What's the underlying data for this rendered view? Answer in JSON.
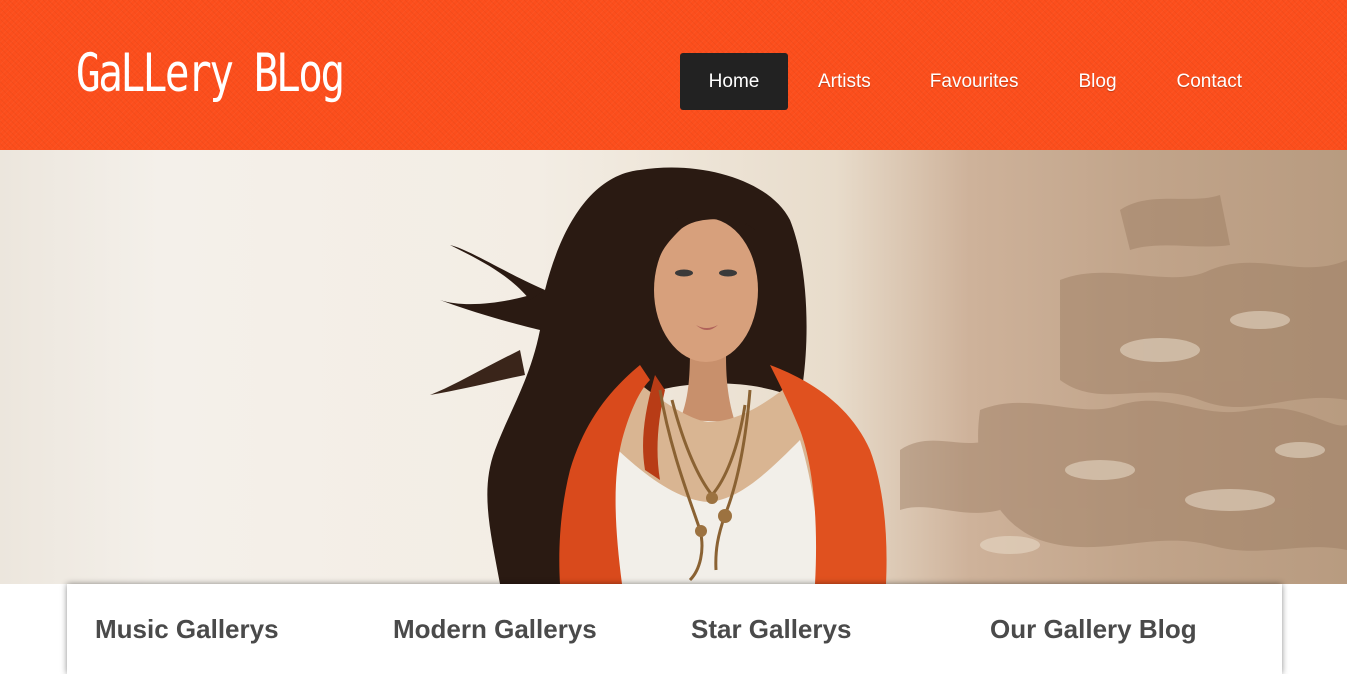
{
  "site": {
    "logo_text": "GaLLery BLog"
  },
  "nav": {
    "items": [
      {
        "label": "Home",
        "active": true
      },
      {
        "label": "Artists",
        "active": false
      },
      {
        "label": "Favourites",
        "active": false
      },
      {
        "label": "Blog",
        "active": false
      },
      {
        "label": "Contact",
        "active": false
      }
    ]
  },
  "hero": {
    "image": "woman-in-orange-cardigan-photo"
  },
  "sections": [
    {
      "title": "Music Gallerys"
    },
    {
      "title": "Modern Gallerys"
    },
    {
      "title": "Star Gallerys"
    },
    {
      "title": "Our Gallery Blog"
    }
  ],
  "colors": {
    "header_bg": "#fc4e1c",
    "nav_active_bg": "#222222",
    "heading_text": "#4a4a4a"
  }
}
